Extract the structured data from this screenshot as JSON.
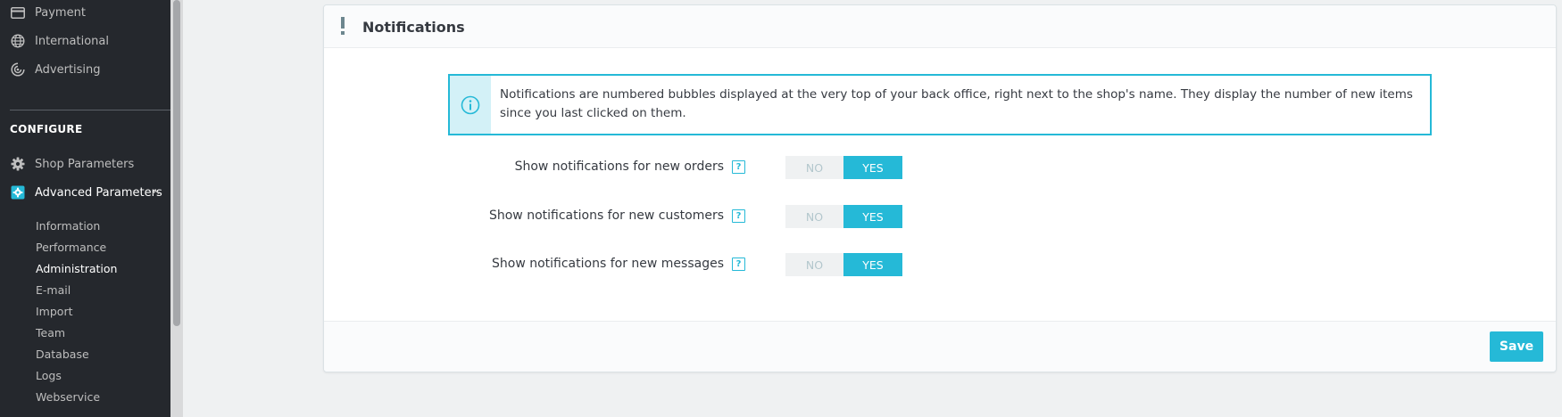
{
  "sidebar": {
    "items_top": [
      {
        "label": "Payment",
        "icon": "payment-card-icon"
      },
      {
        "label": "International",
        "icon": "globe-icon"
      },
      {
        "label": "Advertising",
        "icon": "target-icon"
      }
    ],
    "section_title": "CONFIGURE",
    "configure_items": [
      {
        "label": "Shop Parameters",
        "icon": "gear-icon"
      },
      {
        "label": "Advanced Parameters",
        "icon": "advanced-gear-icon"
      }
    ],
    "sub_items": [
      {
        "label": "Information"
      },
      {
        "label": "Performance"
      },
      {
        "label": "Administration"
      },
      {
        "label": "E-mail"
      },
      {
        "label": "Import"
      },
      {
        "label": "Team"
      },
      {
        "label": "Database"
      },
      {
        "label": "Logs"
      },
      {
        "label": "Webservice"
      }
    ],
    "current_sub_item": "Administration"
  },
  "panel": {
    "title": "Notifications",
    "info_text": "Notifications are numbered bubbles displayed at the very top of your back office, right next to the shop's name. They display the number of new items since you last clicked on them.",
    "rows": [
      {
        "label": "Show notifications for new orders",
        "no": "NO",
        "yes": "YES",
        "value": "YES"
      },
      {
        "label": "Show notifications for new customers",
        "no": "NO",
        "yes": "YES",
        "value": "YES"
      },
      {
        "label": "Show notifications for new messages",
        "no": "NO",
        "yes": "YES",
        "value": "YES"
      }
    ],
    "help_glyph": "?",
    "save_label": "Save"
  },
  "colors": {
    "accent": "#25b9d7",
    "sidebar_bg": "#25282d",
    "page_bg": "#eff1f2"
  }
}
